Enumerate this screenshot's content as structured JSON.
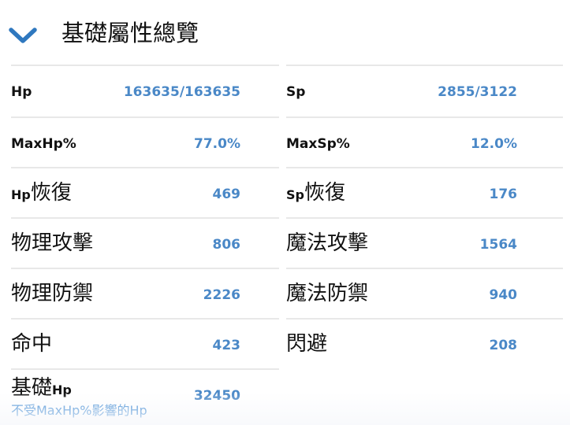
{
  "header": {
    "title": "基礎屬性總覽",
    "toggle_icon": "chevron-down-icon",
    "accent_color": "#3f82c4"
  },
  "stats": {
    "hp": {
      "label": "Hp",
      "value": "163635/163635"
    },
    "sp": {
      "label": "Sp",
      "value": "2855/3122"
    },
    "max_hp_pct": {
      "label": "MaxHp%",
      "value": "77.0%"
    },
    "max_sp_pct": {
      "label": "MaxSp%",
      "value": "12.0%"
    },
    "hp_regen": {
      "label_prefix": "Hp",
      "label_suffix": "恢復",
      "value": "469"
    },
    "sp_regen": {
      "label_prefix": "Sp",
      "label_suffix": "恢復",
      "value": "176"
    },
    "physical_attack": {
      "label": "物理攻擊",
      "value": "806"
    },
    "magic_attack": {
      "label": "魔法攻擊",
      "value": "1564"
    },
    "physical_defense": {
      "label": "物理防禦",
      "value": "2226"
    },
    "magic_defense": {
      "label": "魔法防禦",
      "value": "940"
    },
    "hit": {
      "label": "命中",
      "value": "423"
    },
    "dodge": {
      "label": "閃避",
      "value": "208"
    },
    "base_hp": {
      "label_prefix": "基礎",
      "label_suffix": "Hp",
      "value": "32450",
      "note": "不受MaxHp%影響的Hp"
    }
  },
  "colors": {
    "value": "#4a88c7",
    "note": "#3d89d3",
    "label": "#111111",
    "divider": "#e8e8e8"
  }
}
